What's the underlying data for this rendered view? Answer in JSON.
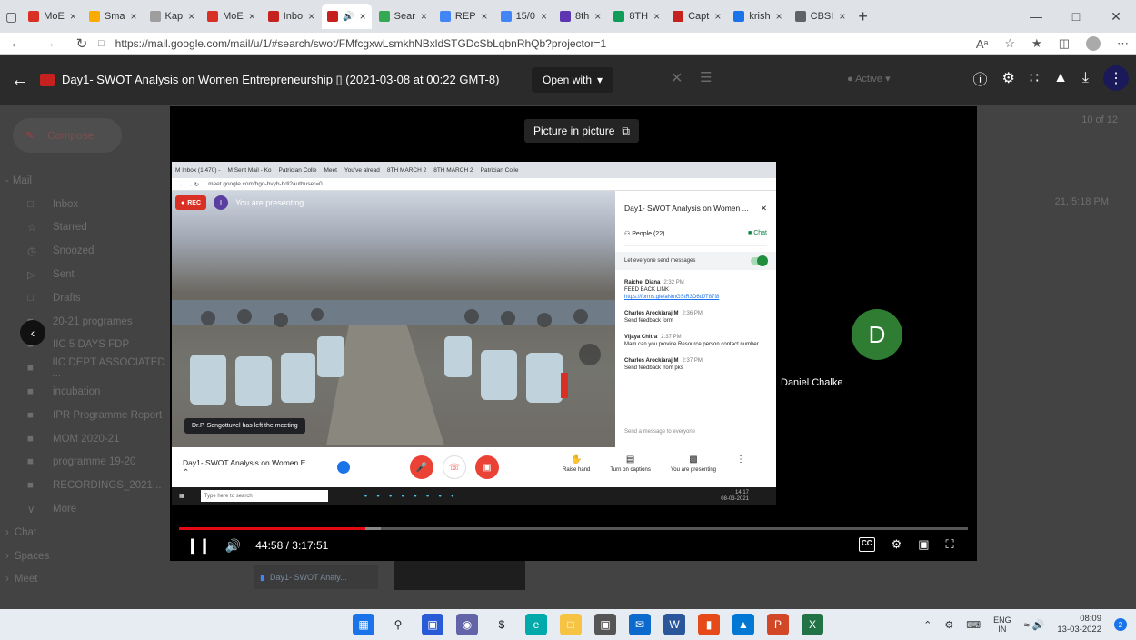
{
  "browser": {
    "tabs": [
      {
        "label": "MoE",
        "color": "#d93025"
      },
      {
        "label": "Sma",
        "color": "#f9ab00"
      },
      {
        "label": "Kap",
        "color": "#9e9e9e"
      },
      {
        "label": "MoE",
        "color": "#d93025"
      },
      {
        "label": "Inbo",
        "color": "#c5221f"
      },
      {
        "label": "",
        "color": "#c5221f",
        "active": true
      },
      {
        "label": "Sear",
        "color": "#34a853"
      },
      {
        "label": "REP",
        "color": "#4285f4"
      },
      {
        "label": "15/0",
        "color": "#4285f4"
      },
      {
        "label": "8th",
        "color": "#5e35b1"
      },
      {
        "label": "8TH",
        "color": "#0f9d58"
      },
      {
        "label": "Capt",
        "color": "#c5221f"
      },
      {
        "label": "krish",
        "color": "#1a73e8"
      },
      {
        "label": "CBSI",
        "color": "#5f6368"
      }
    ],
    "url": "https://mail.google.com/mail/u/1/#search/swot/FMfcgxwLsmkhNBxldSTGDcSbLqbnRhQb?projector=1"
  },
  "viewer": {
    "title": "Day1- SWOT Analysis on Women Entrepreneurship ▯ (2021-03-08 at 00:22 GMT-8)",
    "open_with": "Open with",
    "status": "Active",
    "page_count": "10 of 12",
    "mail_time": "21, 5:18 PM"
  },
  "gmail": {
    "compose": "Compose",
    "mail_header": "Mail",
    "items": [
      {
        "label": "Inbox",
        "icon": "□",
        "name": "inbox"
      },
      {
        "label": "Starred",
        "icon": "☆",
        "name": "starred"
      },
      {
        "label": "Snoozed",
        "icon": "◷",
        "name": "snoozed"
      },
      {
        "label": "Sent",
        "icon": "▷",
        "name": "sent"
      },
      {
        "label": "Drafts",
        "icon": "□",
        "name": "drafts"
      },
      {
        "label": "20-21 programes",
        "icon": "■",
        "name": "label-20-21"
      },
      {
        "label": "IIC 5 DAYS FDP",
        "icon": "■",
        "name": "label-iic-fdp"
      },
      {
        "label": "IIC DEPT ASSOCIATED ...",
        "icon": "■",
        "name": "label-iic-dept"
      },
      {
        "label": "incubation",
        "icon": "■",
        "name": "label-incubation"
      },
      {
        "label": "IPR Programme Report",
        "icon": "■",
        "name": "label-ipr"
      },
      {
        "label": "MOM 2020-21",
        "icon": "■",
        "name": "label-mom"
      },
      {
        "label": "programme 19-20",
        "icon": "■",
        "name": "label-programme"
      },
      {
        "label": "RECORDINGS_2021...",
        "icon": "■",
        "name": "label-recordings"
      },
      {
        "label": "More",
        "icon": "∨",
        "name": "more"
      }
    ],
    "sections": [
      "Chat",
      "Spaces",
      "Meet"
    ]
  },
  "player": {
    "pip_label": "Picture in picture",
    "current_time": "44:58",
    "duration": "3:17:51",
    "progress": 0.236,
    "cc": "CC",
    "attachment": "Day1- SWOT Analy..."
  },
  "meet": {
    "inner_tabs": [
      "M Inbox (1,470) - ",
      "M Sent Mail - Ko",
      "Patrician Colle",
      "Meet",
      "You've alread",
      "8TH MARCH 2",
      "8TH MARCH 2",
      "Patrician Colle"
    ],
    "inner_url": "meet.google.com/hgo-bvyb-hdi?authuser=0",
    "rec": "REC",
    "presenting_label": "You are presenting",
    "toast": "Dr.P. Sengottuvel has left the meeting",
    "chat_title": "Day1- SWOT Analysis on Women ...",
    "people_tab": "People (22)",
    "chat_tab": "Chat",
    "toggle_label": "Let everyone send messages",
    "messages": [
      {
        "who": "Raichel Diana",
        "when": "2:32 PM",
        "lines": [
          "FEED BACK LINK"
        ],
        "link": "https://forms.gle/aNmGStR3D6dJT87f8"
      },
      {
        "who": "Charles Arockiaraj M",
        "when": "2:36 PM",
        "lines": [
          "Send feedback form"
        ],
        "link": ""
      },
      {
        "who": "Vijaya Chitra",
        "when": "2:37 PM",
        "lines": [
          "Mam can you provide Resource person contact number"
        ],
        "link": ""
      },
      {
        "who": "Charles Arockiaraj M",
        "when": "2:37 PM",
        "lines": [
          "Send feedback from pks"
        ],
        "link": ""
      }
    ],
    "send_placeholder": "Send a message to everyone",
    "meeting_title": "Day1- SWOT Analysis on Women E...",
    "raise_hand": "Raise hand",
    "captions": "Turn on captions",
    "presenting": "You are presenting",
    "inner_search": "Type here to search",
    "inner_clock": "14:17",
    "inner_date": "08-03-2021"
  },
  "participant": {
    "initial": "D",
    "name": "Daniel Chalke",
    "color": "#2e7d32"
  },
  "taskbar": {
    "lang_top": "ENG",
    "lang_bottom": "IN",
    "time": "08:09",
    "date": "13-03-2022",
    "notifications": "2"
  }
}
